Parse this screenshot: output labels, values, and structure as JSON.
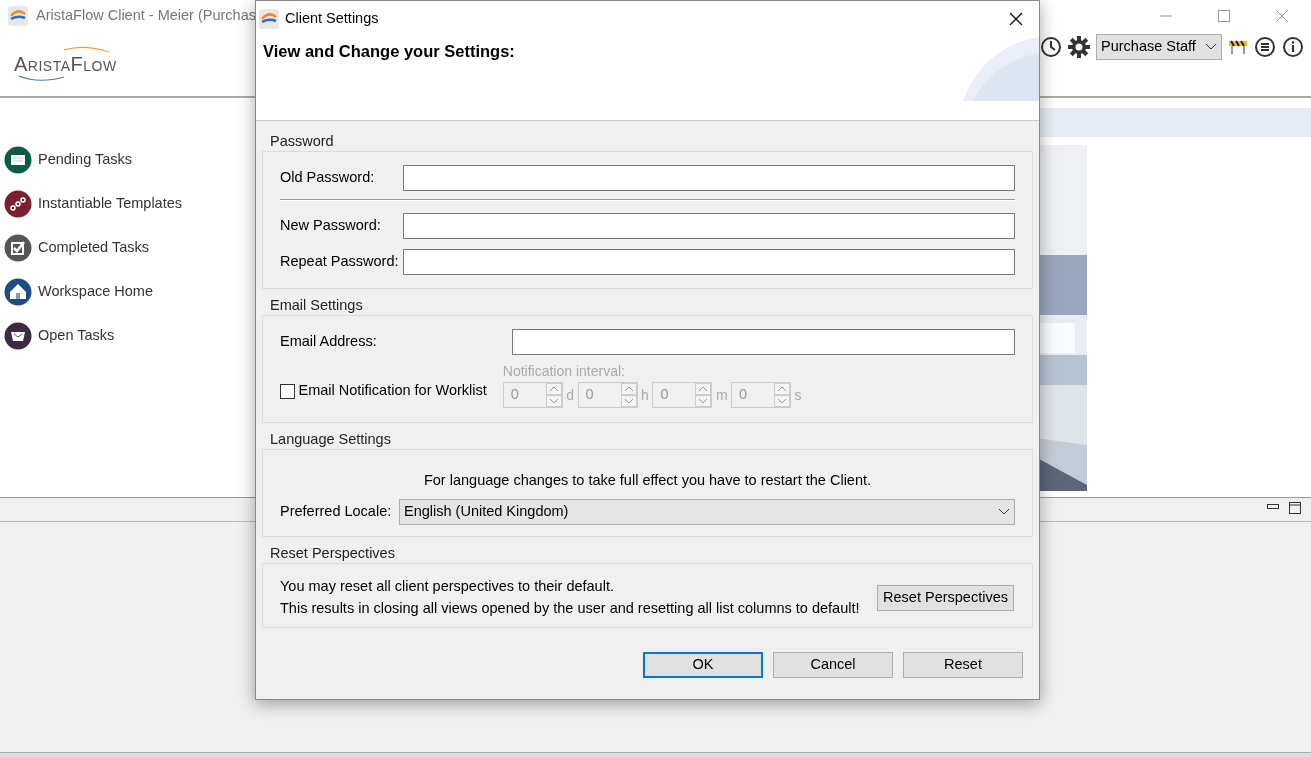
{
  "app": {
    "title": "AristaFlow Client - Meier (Purchas",
    "logo": "AristaFlow",
    "role_select": "Purchase Staff"
  },
  "sidebar": {
    "items": [
      {
        "label": "Pending Tasks",
        "kind": "inbox",
        "color": "#0d5c45"
      },
      {
        "label": "Instantiable Templates",
        "kind": "template",
        "color": "#7b1f2e"
      },
      {
        "label": "Completed Tasks",
        "kind": "check",
        "color": "#555555"
      },
      {
        "label": "Workspace Home",
        "kind": "home",
        "color": "#1e4d86"
      },
      {
        "label": "Open Tasks",
        "kind": "open",
        "color": "#3d2b45"
      }
    ]
  },
  "dialog": {
    "title": "Client Settings",
    "heading": "View and Change your Settings:",
    "password": {
      "title": "Password",
      "fields": [
        {
          "label": "Old Password:"
        },
        {
          "label": "New Password:"
        },
        {
          "label": "Repeat Password:"
        }
      ]
    },
    "email": {
      "title": "Email Settings",
      "address_label": "Email Address:",
      "notification": {
        "label": "Email Notification for Worklist",
        "checked": false
      },
      "interval": {
        "label": "Notification interval:",
        "disabled": true,
        "units": [
          {
            "value": "0",
            "unit": "d"
          },
          {
            "value": "0",
            "unit": "h"
          },
          {
            "value": "0",
            "unit": "m"
          },
          {
            "value": "0",
            "unit": "s"
          }
        ]
      }
    },
    "language": {
      "title": "Language Settings",
      "note": "For language changes to take full effect you have to restart the Client.",
      "locale_label": "Preferred Locale:",
      "locale": "English (United Kingdom)"
    },
    "reset": {
      "title": "Reset Perspectives",
      "lines": [
        "You may reset all client perspectives to their default.",
        "This results in closing all views opened by the user and resetting all list columns to default!"
      ],
      "button": "Reset Perspectives"
    },
    "buttons": [
      {
        "label": "OK",
        "default": true
      },
      {
        "label": "Cancel",
        "default": false
      },
      {
        "label": "Reset",
        "default": false
      }
    ]
  }
}
